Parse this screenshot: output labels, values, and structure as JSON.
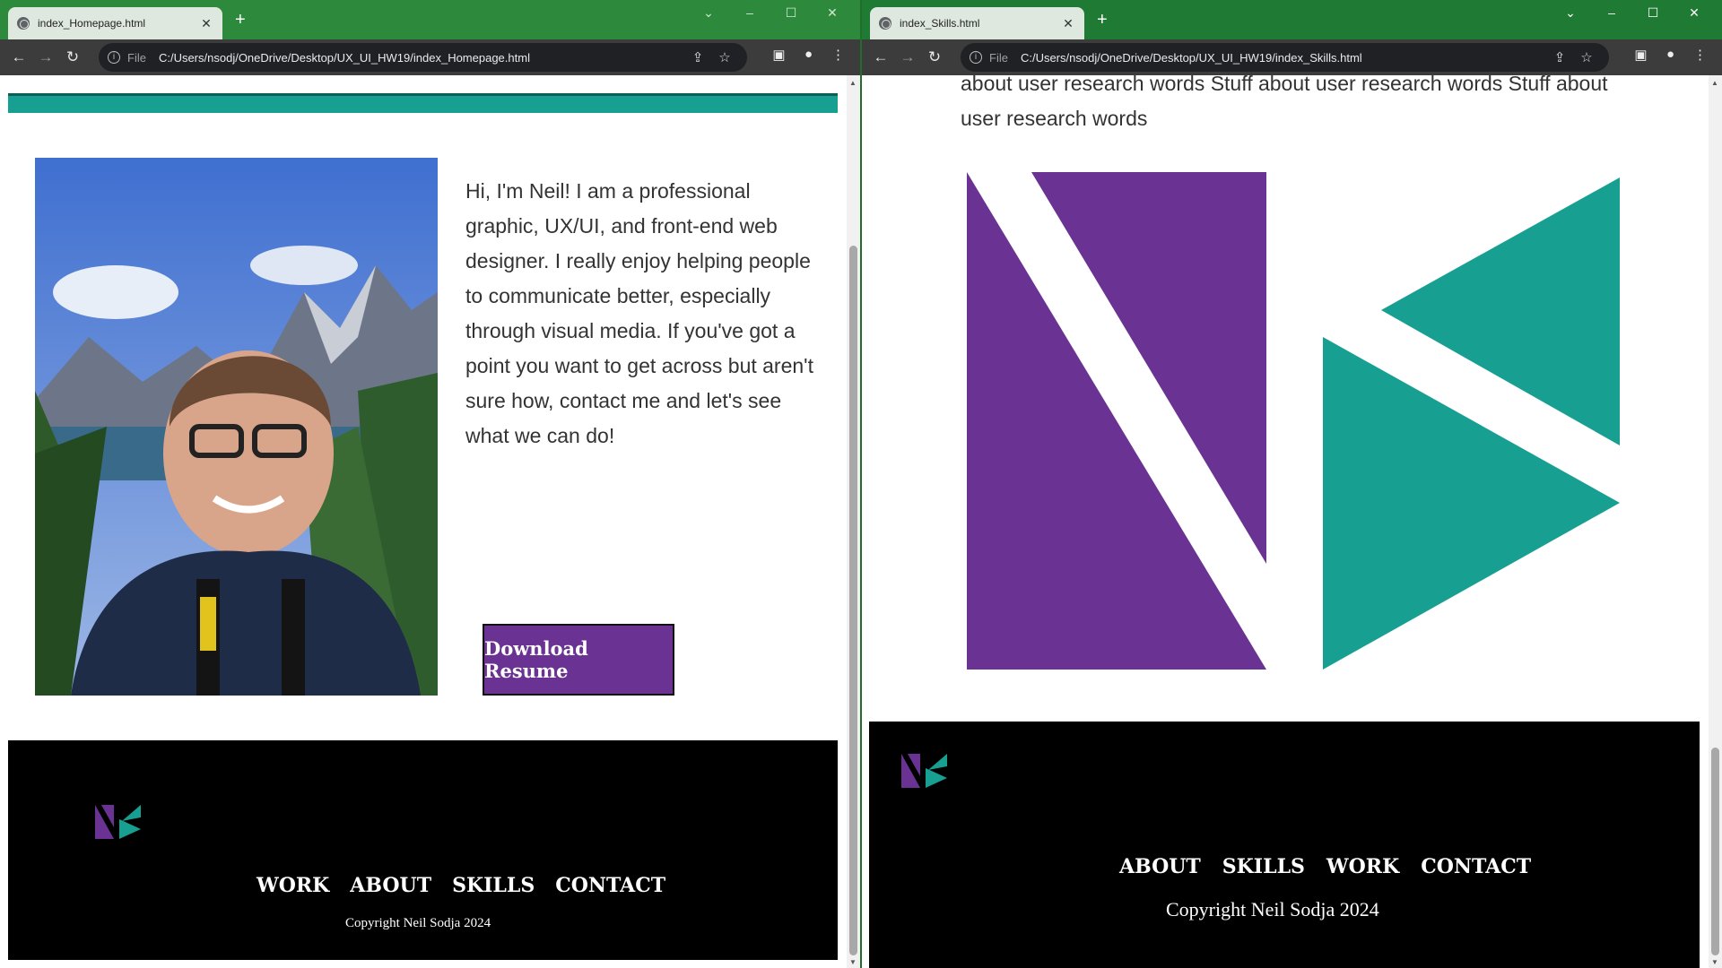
{
  "left_window": {
    "tab_title": "index_Homepage.html",
    "url_scheme": "File",
    "url": "C:/Users/nsodj/OneDrive/Desktop/UX_UI_HW19/index_Homepage.html",
    "page": {
      "bio": "Hi, I'm Neil! I am a professional graphic, UX/UI, and front-end web designer. I really enjoy helping people to communicate better, especially through visual media. If you've got a point you want to get across but aren't sure how, contact me and let's see what we can do!",
      "resume_button": "Download Resume",
      "footer_nav": [
        "WORK",
        "ABOUT",
        "SKILLS",
        "CONTACT"
      ],
      "copyright": "Copyright Neil Sodja 2024"
    }
  },
  "right_window": {
    "tab_title": "index_Skills.html",
    "url_scheme": "File",
    "url": "C:/Users/nsodj/OneDrive/Desktop/UX_UI_HW19/index_Skills.html",
    "page": {
      "body_text": "about user research words Stuff about user research words Stuff about user research words",
      "footer_nav": [
        "ABOUT",
        "SKILLS",
        "WORK",
        "CONTACT"
      ],
      "copyright": "Copyright Neil Sodja 2024"
    }
  },
  "colors": {
    "purple": "#6a3393",
    "teal": "#17a092",
    "chrome_green": "#2d8a3d"
  }
}
